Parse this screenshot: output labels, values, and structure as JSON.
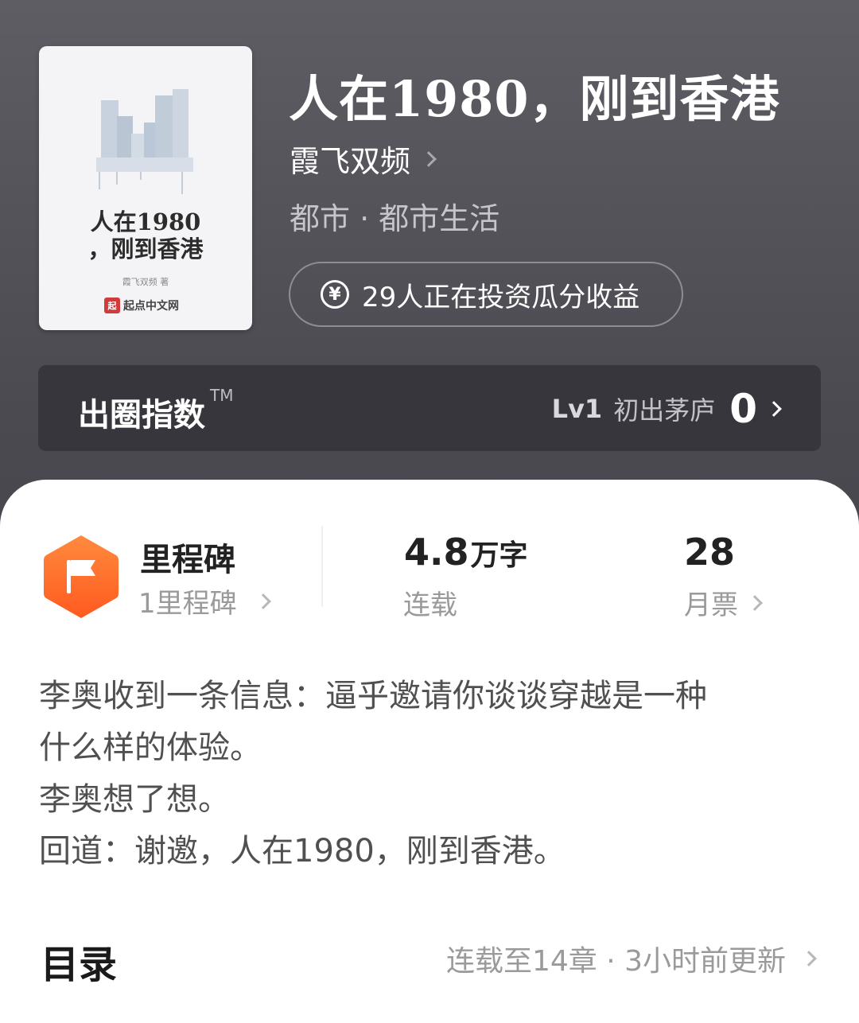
{
  "book": {
    "cover": {
      "title_line1": "人在1980",
      "title_line2": "，刚到香港",
      "author": "霞飞双频 著",
      "publisher_logo": "起",
      "publisher": "起点中文网"
    },
    "title": "人在1980，刚到香港",
    "author": "霞飞双频",
    "category": "都市 · 都市生活",
    "invest_text": "29人正在投资瓜分收益",
    "invest_icon": "yen-circle-icon"
  },
  "popularity_index": {
    "label": "出圈指数",
    "trademark": "TM",
    "level_code": "Lv1",
    "level_name": "初出茅庐",
    "value": "0"
  },
  "stats": {
    "milestone": {
      "title": "里程碑",
      "subtitle": "1里程碑",
      "icon": "flag-icon",
      "icon_color": "#ff6a2a"
    },
    "words": {
      "value": "4.8",
      "unit": "万字",
      "label": "连载"
    },
    "monthly_tickets": {
      "value": "28",
      "label": "月票"
    }
  },
  "synopsis": [
    "李奥收到一条信息：逼乎邀请你谈谈穿越是一种",
    "什么样的体验。",
    "李奥想了想。",
    "回道：谢邀，人在1980，刚到香港。"
  ],
  "toc": {
    "title": "目录",
    "status": "连载至14章 · 3小时前更新"
  }
}
